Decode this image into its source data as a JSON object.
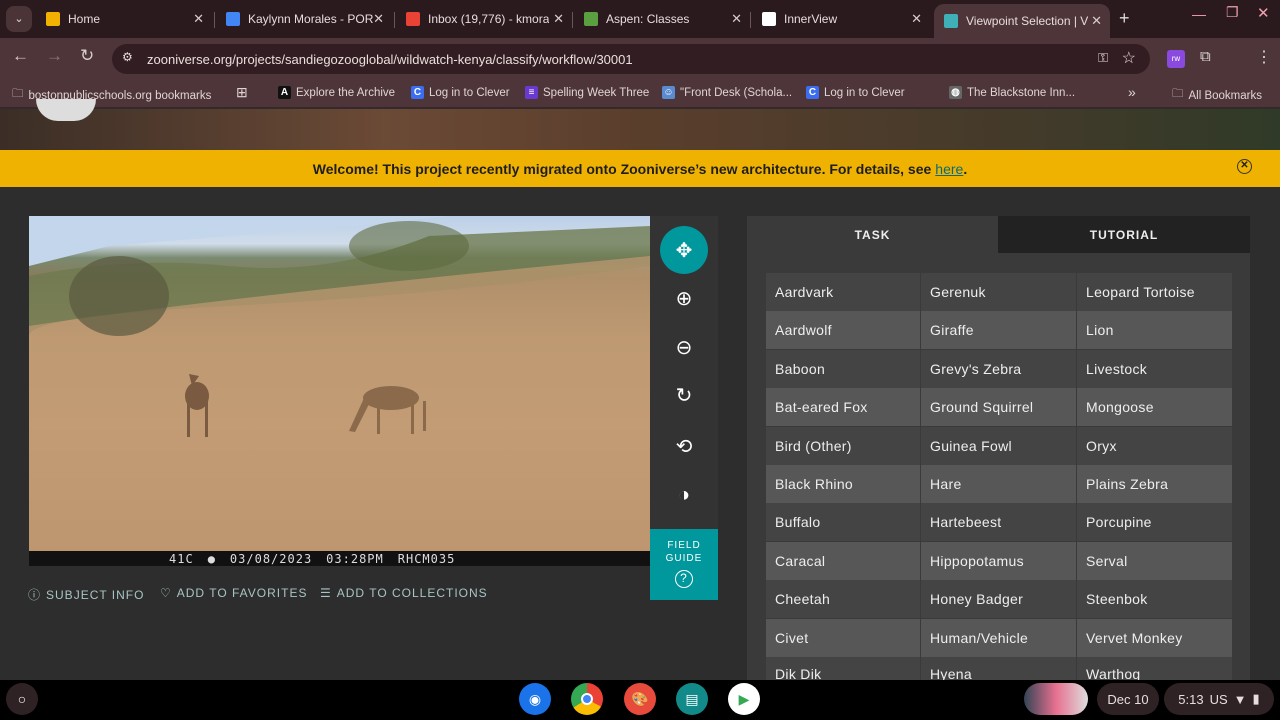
{
  "browser": {
    "tabs": [
      {
        "label": "Home",
        "icon": "google-classroom-icon",
        "color": "#f2b100"
      },
      {
        "label": "Kaylynn Morales - POR",
        "icon": "google-docs-icon",
        "color": "#4285f4"
      },
      {
        "label": "Inbox (19,776) - kmora",
        "icon": "gmail-icon",
        "color": "#ea4335"
      },
      {
        "label": "Aspen: Classes",
        "icon": "aspen-leaf-icon",
        "color": "#5aa040"
      },
      {
        "label": "InnerView",
        "icon": "innerview-icon",
        "color": "#ffffff"
      },
      {
        "label": "Viewpoint Selection | V",
        "icon": "zooniverse-icon",
        "color": "#3fb0b8"
      }
    ],
    "new_tab": "+",
    "url": "zooniverse.org/projects/sandiegozooglobal/wildwatch-kenya/classify/workflow/30001",
    "bookmarks": [
      {
        "label": "bostonpublicschools.org bookmarks"
      },
      {
        "label": "Explore the Archive",
        "glyph": "A"
      },
      {
        "label": "Log in to Clever",
        "glyph": "C"
      },
      {
        "label": "Spelling Week Three",
        "glyph": "≡"
      },
      {
        "label": "\"Front Desk (Schola...",
        "glyph": "☺"
      },
      {
        "label": "Log in to Clever",
        "glyph": "C"
      },
      {
        "label": "The Blackstone Inn...",
        "glyph": "◍"
      }
    ],
    "more": "»",
    "all_bookmarks": "All Bookmarks",
    "extension_label": "rw"
  },
  "banner": {
    "text": "Welcome! This project recently migrated onto Zooniverse’s new architecture. For details, see",
    "link": "here",
    "end": "."
  },
  "subject": {
    "temp": "41C",
    "date": "03/08/2023",
    "time": "03:28PM",
    "camera": "RHCM035"
  },
  "field_guide": {
    "line1": "FIELD",
    "line2": "GUIDE",
    "icon": "?"
  },
  "meta": {
    "subject_info": "SUBJECT INFO",
    "favorites": "ADD TO FAVORITES",
    "collections": "ADD TO COLLECTIONS"
  },
  "task_tabs": {
    "task": "TASK",
    "tutorial": "TUTORIAL"
  },
  "species": [
    [
      "Aardvark",
      "Gerenuk",
      "Leopard Tortoise"
    ],
    [
      "Aardwolf",
      "Giraffe",
      "Lion"
    ],
    [
      "Baboon",
      "Grevy's Zebra",
      "Livestock"
    ],
    [
      "Bat-eared Fox",
      "Ground Squirrel",
      "Mongoose"
    ],
    [
      "Bird (Other)",
      "Guinea Fowl",
      "Oryx"
    ],
    [
      "Black Rhino",
      "Hare",
      "Plains Zebra"
    ],
    [
      "Buffalo",
      "Hartebeest",
      "Porcupine"
    ],
    [
      "Caracal",
      "Hippopotamus",
      "Serval"
    ],
    [
      "Cheetah",
      "Honey Badger",
      "Steenbok"
    ],
    [
      "Civet",
      "Human/Vehicle",
      "Vervet Monkey"
    ],
    [
      "Dik Dik",
      "Hyena",
      "Warthog"
    ]
  ],
  "shelf": {
    "date": "Dec 10",
    "time": "5:13",
    "locale": "US"
  }
}
